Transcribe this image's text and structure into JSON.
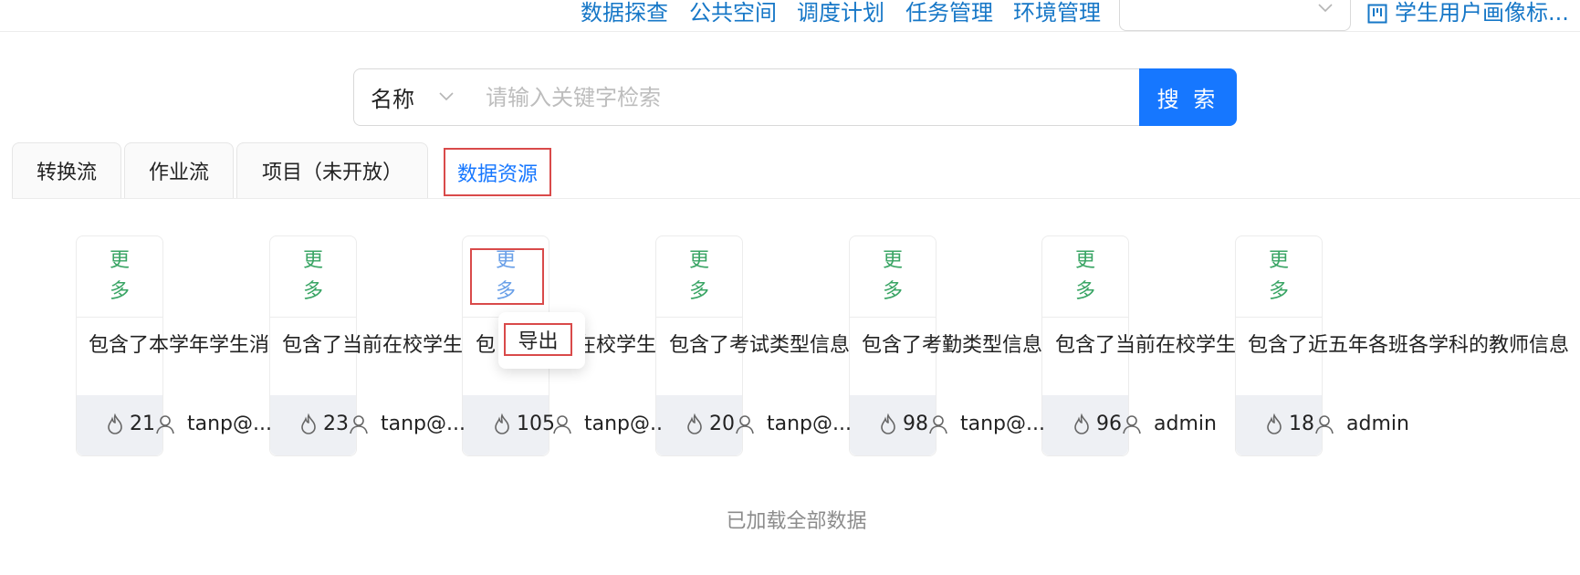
{
  "nav": {
    "links": [
      "数据探查",
      "公共空间",
      "调度计划",
      "任务管理",
      "环境管理"
    ],
    "select_value": "",
    "project": "学生用户画像标..."
  },
  "search": {
    "type": "名称",
    "placeholder": "请输入关键字检索",
    "button": "搜 索"
  },
  "tabs": [
    "转换流",
    "作业流",
    "项目（未开放）",
    "数据资源"
  ],
  "cards": [
    {
      "more": [
        "更",
        "多"
      ],
      "desc": "包含了本学年学生消",
      "count": "21",
      "owner": "tanp@..."
    },
    {
      "more": [
        "更",
        "多"
      ],
      "desc": "包含了当前在校学生",
      "count": "23",
      "owner": "tanp@..."
    },
    {
      "more": [
        "更",
        "多"
      ],
      "desc": "包",
      "desc_tail": "在校学生",
      "count": "105",
      "owner": "tanp@.."
    },
    {
      "more": [
        "更",
        "多"
      ],
      "desc": "包含了考试类型信息",
      "count": "20",
      "owner": "tanp@..."
    },
    {
      "more": [
        "更",
        "多"
      ],
      "desc": "包含了考勤类型信息",
      "count": "98",
      "owner": "tanp@..."
    },
    {
      "more": [
        "更",
        "多"
      ],
      "desc": "包含了当前在校学生",
      "count": "96",
      "owner": "admin"
    },
    {
      "more": [
        "更",
        "多"
      ],
      "desc": "包含了近五年各班各学科的教师信息",
      "count": "18",
      "owner": "admin"
    }
  ],
  "popup": {
    "export": "导出"
  },
  "footer": {
    "loaded": "已加载全部数据"
  },
  "colors": {
    "primary": "#1677ff",
    "link": "#1677c7",
    "more": "#3aa565",
    "highlight": "#d94a4a"
  }
}
